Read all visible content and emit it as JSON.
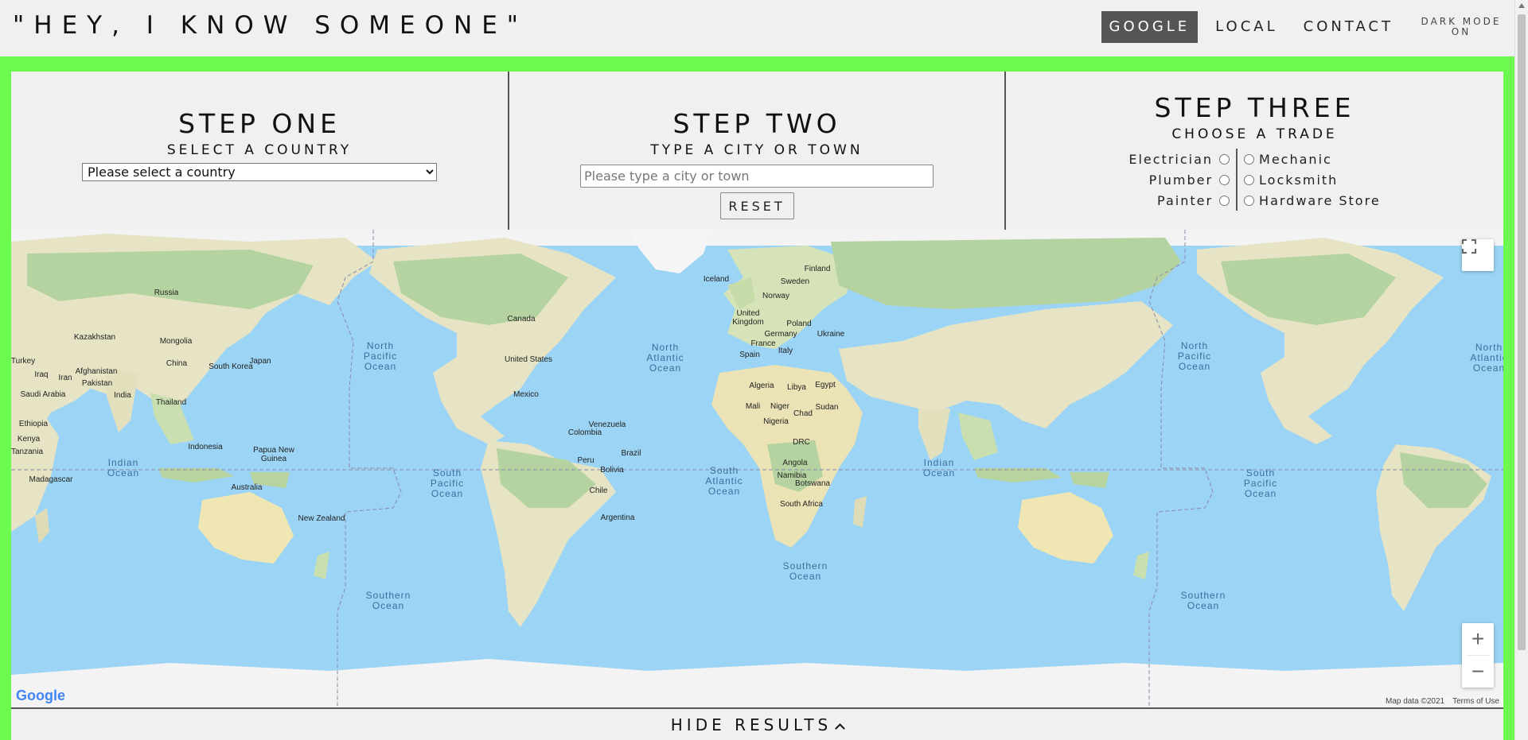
{
  "header": {
    "title": "\"HEY, I KNOW SOMEONE\"",
    "nav": [
      {
        "label": "GOOGLE",
        "active": true
      },
      {
        "label": "LOCAL",
        "active": false
      },
      {
        "label": "CONTACT",
        "active": false
      }
    ],
    "dark_mode_line1": "DARK MODE",
    "dark_mode_line2": "ON"
  },
  "steps": {
    "one": {
      "heading": "STEP ONE",
      "sub": "SELECT A COUNTRY",
      "select_value": "Please select a country"
    },
    "two": {
      "heading": "STEP TWO",
      "sub": "TYPE A CITY OR TOWN",
      "placeholder": "Please type a city or town",
      "reset_label": "RESET"
    },
    "three": {
      "heading": "STEP THREE",
      "sub": "CHOOSE A TRADE",
      "trades_left": [
        "Electrician",
        "Plumber",
        "Painter"
      ],
      "trades_right": [
        "Mechanic",
        "Locksmith",
        "Hardware Store"
      ]
    }
  },
  "map": {
    "labels": [
      "Russia",
      "Kazakhstan",
      "Mongolia",
      "China",
      "South Korea",
      "Japan",
      "Afghanistan",
      "Pakistan",
      "India",
      "Thailand",
      "Iraq",
      "Iran",
      "Saudi Arabia",
      "Turkey",
      "Ethiopia",
      "Kenya",
      "Tanzania",
      "Madagascar",
      "Indonesia",
      "Papua New Guinea",
      "Australia",
      "New Zealand",
      "Canada",
      "United States",
      "Mexico",
      "Venezuela",
      "Colombia",
      "Brazil",
      "Peru",
      "Bolivia",
      "Chile",
      "Argentina",
      "Iceland",
      "Finland",
      "Sweden",
      "Norway",
      "United Kingdom",
      "Poland",
      "Germany",
      "Ukraine",
      "France",
      "Italy",
      "Spain",
      "Algeria",
      "Libya",
      "Egypt",
      "Mali",
      "Niger",
      "Chad",
      "Sudan",
      "Nigeria",
      "DRC",
      "Angola",
      "Namibia",
      "Botswana",
      "South Africa"
    ],
    "oceans": [
      "North Pacific Ocean",
      "North Atlantic Ocean",
      "Indian Ocean",
      "South Pacific Ocean",
      "South Atlantic Ocean",
      "Southern Ocean"
    ],
    "logo": "Google",
    "map_data": "Map data ©2021",
    "terms": "Terms of Use",
    "zoom_in": "+",
    "zoom_out": "−"
  },
  "hide_results": "HIDE RESULTS",
  "colors": {
    "frame_green": "#6dfa4f",
    "ocean": "#9bd4f4",
    "land": "#e9e5c8",
    "forest": "#b9d7a6"
  }
}
